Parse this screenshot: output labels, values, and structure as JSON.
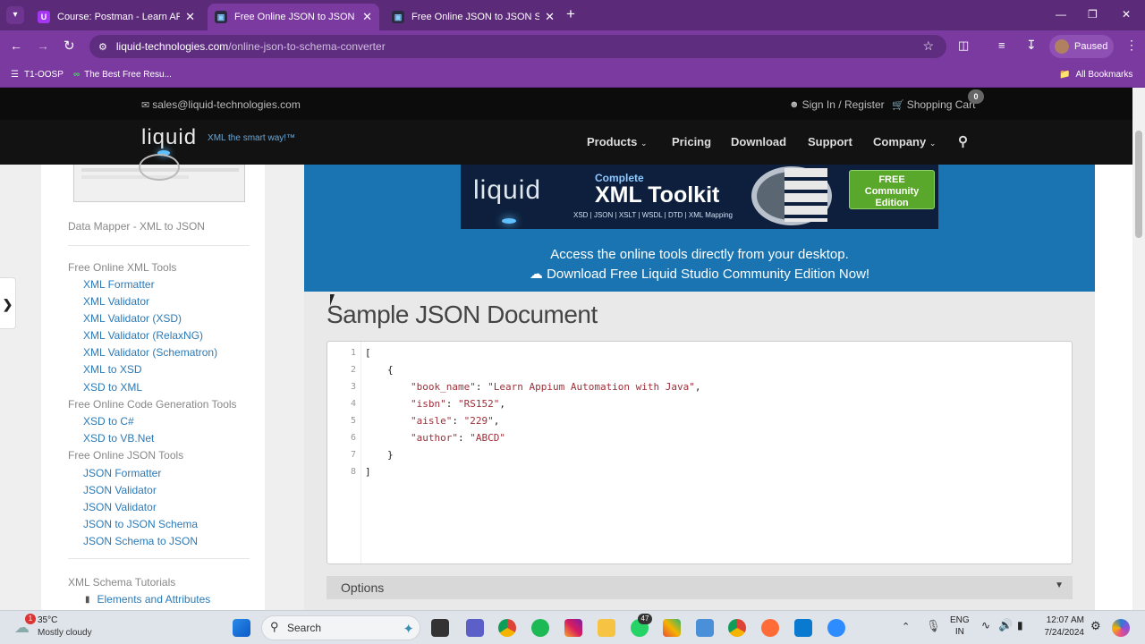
{
  "browser": {
    "tabs": [
      {
        "title": "Course: Postman - Learn API Te",
        "active": false
      },
      {
        "title": "Free Online JSON to JSON Sche",
        "active": true
      },
      {
        "title": "Free Online JSON to JSON Sche",
        "active": false
      }
    ],
    "new_tab": "+",
    "url_host": "liquid-technologies.com",
    "url_path": "/online-json-to-schema-converter",
    "profile_status": "Paused",
    "bookmarks": [
      {
        "label": "T1-OOSP"
      },
      {
        "label": "The Best Free Resu..."
      }
    ],
    "all_bookmarks": "All Bookmarks"
  },
  "site": {
    "email": "sales@liquid-technologies.com",
    "sign_in": "Sign In / Register",
    "cart": "Shopping Cart",
    "cart_count": "0",
    "logo": "liquid",
    "tagline": "XML the smart way!™",
    "nav": [
      "Products",
      "Pricing",
      "Download",
      "Support",
      "Company"
    ]
  },
  "sidebar": {
    "first_item": "Data Mapper - XML to JSON",
    "sections": [
      {
        "heading": "Free Online XML Tools",
        "items": [
          "XML Formatter",
          "XML Validator",
          "XML Validator (XSD)",
          "XML Validator (RelaxNG)",
          "XML Validator (Schematron)",
          "XML to XSD",
          "XSD to XML"
        ]
      },
      {
        "heading": "Free Online Code Generation Tools",
        "items": [
          "XSD to C#",
          "XSD to VB.Net"
        ]
      },
      {
        "heading": "Free Online JSON Tools",
        "items": [
          "JSON Formatter",
          "JSON Validator",
          "JSON Validator",
          "JSON to JSON Schema",
          "JSON Schema to JSON"
        ]
      },
      {
        "heading": "XML Schema Tutorials",
        "items": [
          "Elements and Attributes"
        ]
      }
    ]
  },
  "banner": {
    "toolkit_logo": "liquid",
    "toolkit_complete": "Complete",
    "toolkit_title": "XML Toolkit",
    "toolkit_sub": "XSD | JSON | XSLT | WSDL | DTD | XML Mapping",
    "free_badge": "FREE Community Edition",
    "line1": "Access the online tools directly from your desktop.",
    "line2": "Download Free Liquid Studio Community Edition Now!"
  },
  "main": {
    "title": "Sample JSON Document",
    "line_numbers": [
      "1",
      "2",
      "3",
      "4",
      "5",
      "6",
      "7",
      "8"
    ],
    "code": {
      "l1": "[",
      "l2": "{",
      "l3_key": "\"book_name\"",
      "l3_val": "\"Learn Appium Automation with Java\"",
      "l4_key": "\"isbn\"",
      "l4_val": "\"RS152\"",
      "l5_key": "\"aisle\"",
      "l5_val": "\"229\"",
      "l6_key": "\"author\"",
      "l6_val": "\"ABCD\"",
      "l7": "}",
      "l8": "]"
    },
    "options_label": "Options"
  },
  "taskbar": {
    "weather_temp": "35°C",
    "weather_desc": "Mostly cloudy",
    "weather_badge": "1",
    "search": "Search",
    "whatsapp_badge": "47",
    "lang1": "ENG",
    "lang2": "IN",
    "time": "12:07 AM",
    "date": "7/24/2024"
  }
}
